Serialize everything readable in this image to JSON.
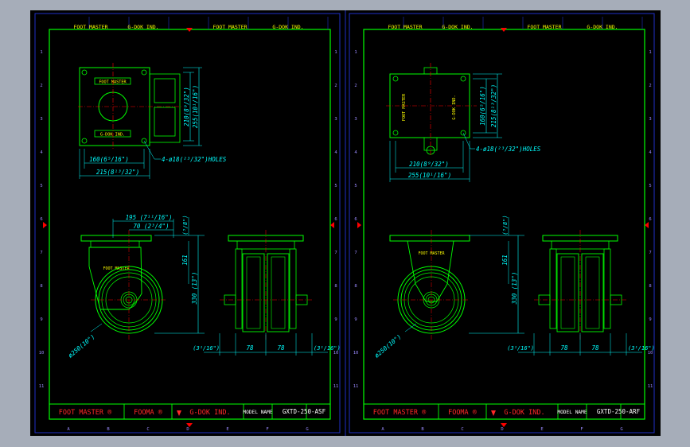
{
  "colors": {
    "background": "#a6adb9",
    "canvas": "#000000",
    "frame": "#1f31c8",
    "border": "#00ff00",
    "part": "#00ff00",
    "dimension": "#00ffff",
    "label": "#ffff00",
    "centerline": "#ff0000",
    "title_text": "#ff2828",
    "marker": "#ff0000",
    "ticks": "#9a8aff"
  },
  "sheets": [
    {
      "header": {
        "left_brand": "FOOT MASTER",
        "left_company": "G-DOK IND.",
        "right_brand": "FOOT MASTER",
        "right_company": "G-DOK IND."
      },
      "plate": {
        "brand": "FOOT MASTER",
        "company": "G-DOK IND."
      },
      "top_dims": {
        "dim_160": "160(6⁵/16\")",
        "dim_215": "215(8¹³/32\")",
        "dim_210": "210(8⁹/32\")",
        "dim_255": "255(10¹/16\")",
        "holes": "4-ø18(²³/32\")HOLES"
      },
      "side_dims": {
        "dim_195": "195 (7¹¹/16\")",
        "dim_70": "70 (2³/4\")",
        "dim_161": "161",
        "dim_fraction": "(⁵/8\")",
        "dim_330": "330 (13\")",
        "diameter": "ø250(10\")",
        "body_label": "FOOT MASTER"
      },
      "front_dims": {
        "left": "(3¹/16\")",
        "mid_left": "78",
        "mid_right": "78",
        "right": "(3¹/16\")"
      },
      "title_block": {
        "brand": "FOOT MASTER",
        "brand2": "FOOMA",
        "company": "G-DOK IND.",
        "model_label": "MODEL  NAME",
        "model_value": "GXTD-250-ASF"
      },
      "zones": [
        "A",
        "B",
        "C",
        "D",
        "E",
        "F",
        "G"
      ],
      "rows": [
        "1",
        "2",
        "3",
        "4",
        "5",
        "6",
        "7",
        "8",
        "9",
        "10",
        "11"
      ]
    },
    {
      "header": {
        "left_brand": "FOOT MASTER",
        "left_company": "G-DOK IND.",
        "right_brand": "FOOT MASTER",
        "right_company": "G-DOK IND."
      },
      "plate": {
        "brand": "FOOT MASTER",
        "company": "G-DOK IND."
      },
      "top_dims": {
        "dim_160": "160(6⁵/16\")",
        "dim_215": "215(8¹³/32\")",
        "dim_210": "210(8⁹/32\")",
        "dim_255": "255(10¹/16\")",
        "holes": "4-ø18(²³/32\")HOLES"
      },
      "side_dims": {
        "dim_161": "161",
        "dim_fraction": "(⁵/8\")",
        "dim_330": "330 (13\")",
        "diameter": "ø250(10\")",
        "body_label": "FOOT MASTER"
      },
      "front_dims": {
        "left": "(3¹/16\")",
        "mid_left": "78",
        "mid_right": "78",
        "right": "(3¹/16\")"
      },
      "title_block": {
        "brand": "FOOT MASTER",
        "brand2": "FOOMA",
        "company": "G-DOK IND.",
        "model_label": "MODEL  NAME",
        "model_value": "GXTD-250-ARF"
      },
      "zones": [
        "A",
        "B",
        "C",
        "D",
        "E",
        "F",
        "G"
      ],
      "rows": [
        "1",
        "2",
        "3",
        "4",
        "5",
        "6",
        "7",
        "8",
        "9",
        "10",
        "11"
      ]
    }
  ]
}
